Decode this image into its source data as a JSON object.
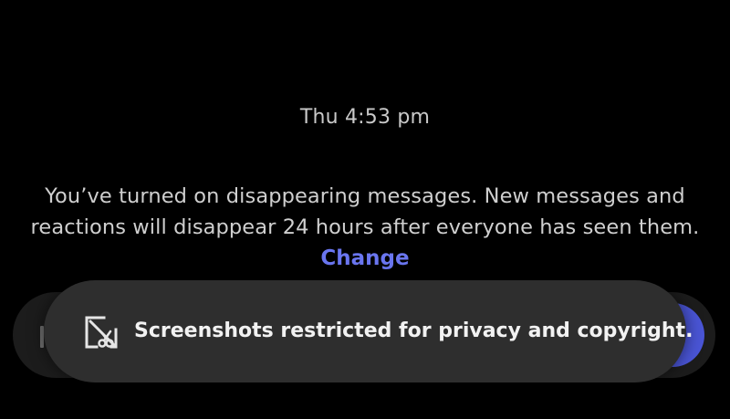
{
  "conversation": {
    "timestamp": "Thu 4:53 pm",
    "notice_line1": "You’ve turned on disappearing messages. New messages and",
    "notice_line2": "reactions will disappear 24 hours after everyone has seen them.",
    "change_label": "Change"
  },
  "toast": {
    "icon": "screenshot-restricted-icon",
    "message": "Screenshots restricted for privacy and copyright."
  },
  "colors": {
    "background": "#000000",
    "accent": "#6a76f0",
    "send_button": "#4a55d6",
    "toast_background": "#2e2e2e"
  }
}
